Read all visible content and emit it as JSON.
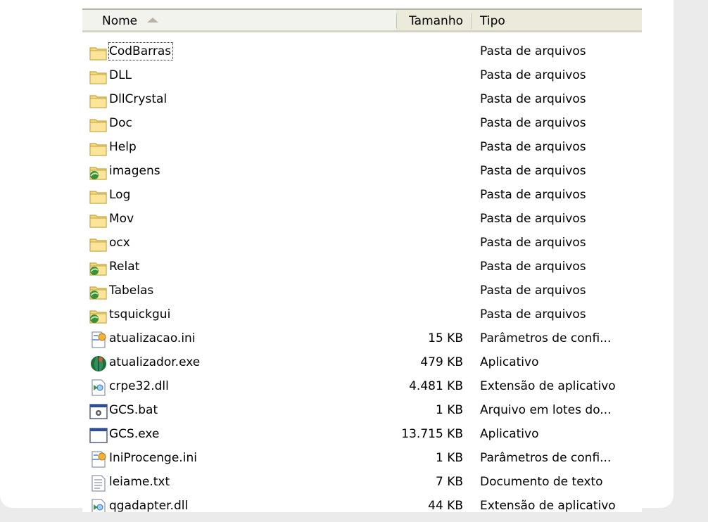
{
  "colors": {
    "folder_fill": "#f6d97a",
    "folder_stroke": "#c4a43e",
    "header_bg": "#ebeadb",
    "page_bg": "#ebebeb"
  },
  "columns": {
    "name": "Nome",
    "size": "Tamanho",
    "type": "Tipo"
  },
  "files": [
    {
      "name": "CodBarras",
      "size": "",
      "type": "Pasta de arquivos",
      "icon": "folder-icon",
      "focused": true
    },
    {
      "name": "DLL",
      "size": "",
      "type": "Pasta de arquivos",
      "icon": "folder-icon"
    },
    {
      "name": "DllCrystal",
      "size": "",
      "type": "Pasta de arquivos",
      "icon": "folder-icon"
    },
    {
      "name": "Doc",
      "size": "",
      "type": "Pasta de arquivos",
      "icon": "folder-icon"
    },
    {
      "name": "Help",
      "size": "",
      "type": "Pasta de arquivos",
      "icon": "folder-icon"
    },
    {
      "name": "imagens",
      "size": "",
      "type": "Pasta de arquivos",
      "icon": "shared-folder-icon"
    },
    {
      "name": "Log",
      "size": "",
      "type": "Pasta de arquivos",
      "icon": "folder-icon"
    },
    {
      "name": "Mov",
      "size": "",
      "type": "Pasta de arquivos",
      "icon": "folder-icon"
    },
    {
      "name": "ocx",
      "size": "",
      "type": "Pasta de arquivos",
      "icon": "folder-icon"
    },
    {
      "name": "Relat",
      "size": "",
      "type": "Pasta de arquivos",
      "icon": "shared-folder-icon"
    },
    {
      "name": "Tabelas",
      "size": "",
      "type": "Pasta de arquivos",
      "icon": "shared-folder-icon"
    },
    {
      "name": "tsquickgui",
      "size": "",
      "type": "Pasta de arquivos",
      "icon": "shared-folder-icon"
    },
    {
      "name": "atualizacao.ini",
      "size": "15 KB",
      "type": "Parâmetros de confi...",
      "icon": "ini-file-icon"
    },
    {
      "name": "atualizador.exe",
      "size": "479 KB",
      "type": "Aplicativo",
      "icon": "updater-app-icon"
    },
    {
      "name": "crpe32.dll",
      "size": "4.481 KB",
      "type": "Extensão de aplicativo",
      "icon": "dll-file-icon"
    },
    {
      "name": "GCS.bat",
      "size": "1 KB",
      "type": "Arquivo em lotes do...",
      "icon": "batch-file-icon"
    },
    {
      "name": "GCS.exe",
      "size": "13.715 KB",
      "type": "Aplicativo",
      "icon": "app-window-icon"
    },
    {
      "name": "IniProcenge.ini",
      "size": "1 KB",
      "type": "Parâmetros de confi...",
      "icon": "ini-file-icon"
    },
    {
      "name": "leiame.txt",
      "size": "7 KB",
      "type": "Documento de texto",
      "icon": "text-file-icon"
    },
    {
      "name": "qgadapter.dll",
      "size": "44 KB",
      "type": "Extensão de aplicativo",
      "icon": "dll-file-icon"
    }
  ]
}
